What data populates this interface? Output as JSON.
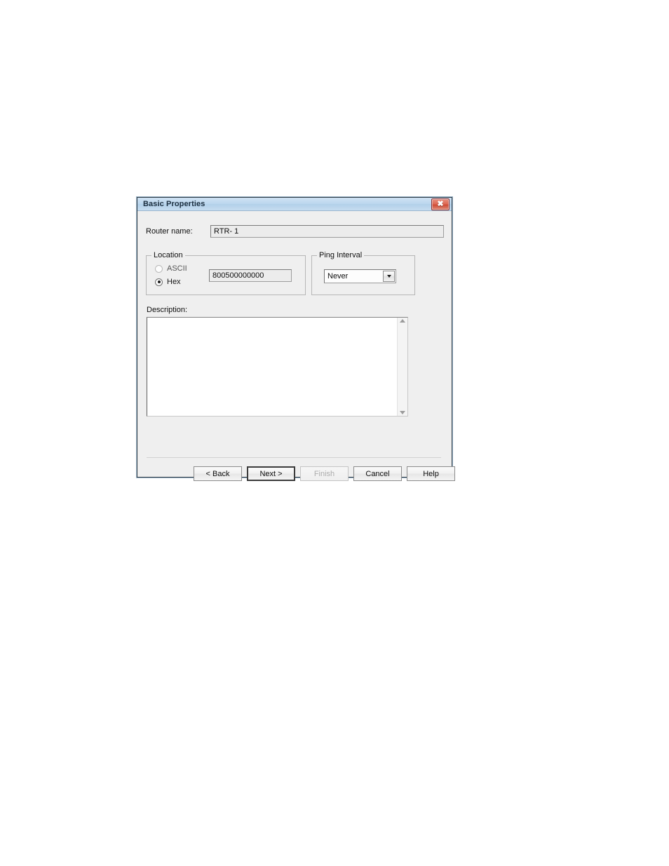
{
  "dialog": {
    "title": "Basic Properties",
    "close_label": "✖",
    "close_icon": "close-icon"
  },
  "form": {
    "router_name_label": "Router name:",
    "router_name_value": "RTR- 1",
    "location": {
      "group_label": "Location",
      "ascii_label": "ASCII",
      "hex_label": "Hex",
      "selected": "Hex",
      "value": "800500000000"
    },
    "ping_interval": {
      "group_label": "Ping Interval",
      "selected": "Never",
      "dropdown_icon": "chevron-down-icon"
    },
    "description": {
      "label": "Description:",
      "value": "",
      "scroll_up_icon": "scroll-up-arrow-icon",
      "scroll_down_icon": "scroll-down-arrow-icon"
    }
  },
  "footer": {
    "buttons": [
      {
        "name": "back",
        "label": "< Back",
        "state": "enabled"
      },
      {
        "name": "next",
        "label": "Next >",
        "state": "default"
      },
      {
        "name": "finish",
        "label": "Finish",
        "state": "disabled"
      },
      {
        "name": "cancel",
        "label": "Cancel",
        "state": "enabled"
      },
      {
        "name": "help",
        "label": "Help",
        "state": "enabled"
      }
    ]
  },
  "colors": {
    "titlebar": "#bcd7ee",
    "body": "#efefef",
    "close_button": "#cf4b35",
    "border": "#2b3a45"
  }
}
